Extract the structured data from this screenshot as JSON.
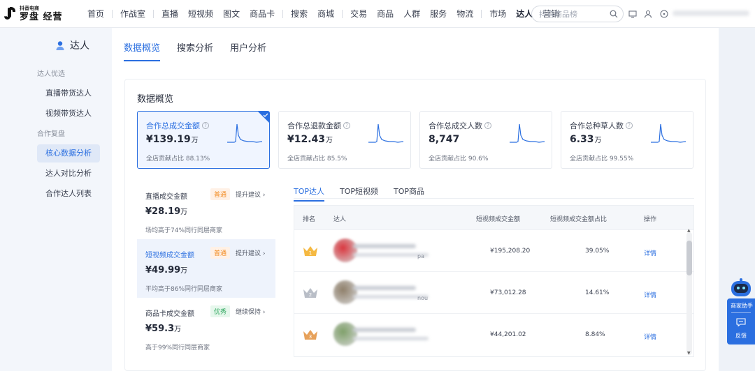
{
  "logo": {
    "small": "抖音电商",
    "big": "罗盘 经营"
  },
  "nav": [
    {
      "label": "首页"
    },
    {
      "sep": true
    },
    {
      "label": "作战室"
    },
    {
      "sep": true
    },
    {
      "label": "直播"
    },
    {
      "label": "短视频"
    },
    {
      "label": "图文"
    },
    {
      "label": "商品卡"
    },
    {
      "sep": true
    },
    {
      "label": "搜索"
    },
    {
      "label": "商城"
    },
    {
      "sep": true
    },
    {
      "label": "交易"
    },
    {
      "label": "商品"
    },
    {
      "label": "人群"
    },
    {
      "label": "服务"
    },
    {
      "label": "物流"
    },
    {
      "sep": true
    },
    {
      "label": "市场"
    },
    {
      "label": "达人",
      "active": true
    },
    {
      "label": "营销"
    }
  ],
  "search": {
    "placeholder": "抖音商品榜"
  },
  "sidebar": {
    "title": "达人",
    "groups": [
      {
        "name": "达人优选",
        "items": [
          {
            "label": "直播带货达人"
          },
          {
            "label": "视频带货达人"
          }
        ]
      },
      {
        "name": "合作复盘",
        "items": [
          {
            "label": "核心数据分析",
            "active": true
          },
          {
            "label": "达人对比分析"
          },
          {
            "label": "合作达人列表"
          }
        ]
      }
    ]
  },
  "tabs": [
    {
      "label": "数据概览",
      "active": true
    },
    {
      "label": "搜索分析"
    },
    {
      "label": "用户分析"
    }
  ],
  "panel_title": "数据概览",
  "kpis": [
    {
      "label": "合作总成交金额",
      "value": "¥139.19",
      "unit": "万",
      "sub": "全店贡献占比 88.13%",
      "active": true
    },
    {
      "label": "合作总退款金额",
      "value": "¥12.43",
      "unit": "万",
      "sub": "全店贡献占比 85.5%"
    },
    {
      "label": "合作总成交人数",
      "value": "8,747",
      "unit": "",
      "sub": "全店贡献占比 90.6%"
    },
    {
      "label": "合作总种草人数",
      "value": "6.33",
      "unit": "万",
      "sub": "全店贡献占比 99.55%"
    }
  ],
  "metrics": [
    {
      "label": "直播成交金额",
      "badge": "普通",
      "badge_type": "normal",
      "advice": "提升建议 ›",
      "value": "¥28.19",
      "unit": "万",
      "sub": "场均高于74%同行同层商家"
    },
    {
      "label": "短视频成交金额",
      "badge": "普通",
      "badge_type": "normal",
      "advice": "提升建议 ›",
      "value": "¥49.99",
      "unit": "万",
      "sub": "平均高于86%同行同层商家",
      "active": true
    },
    {
      "label": "商品卡成交金额",
      "badge": "优秀",
      "badge_type": "good",
      "advice": "继续保持 ›",
      "value": "¥59.3",
      "unit": "万",
      "sub": "高于99%同行同层商家"
    }
  ],
  "sub_tabs": [
    {
      "label": "TOP达人",
      "active": true
    },
    {
      "label": "TOP短视频"
    },
    {
      "label": "TOP商品"
    }
  ],
  "table": {
    "headers": {
      "rank": "排名",
      "talent": "达人",
      "gmv": "短视频成交金额",
      "share": "短视频成交金额占比",
      "op": "操作"
    },
    "rows": [
      {
        "rank": "1",
        "suffix": "pa",
        "gmv": "¥195,208.20",
        "share": "39.05%",
        "op": "详情",
        "medal": "#f5b942",
        "avatar": "#d9363e"
      },
      {
        "rank": "2",
        "suffix": "nou",
        "gmv": "¥73,012.28",
        "share": "14.61%",
        "op": "详情",
        "medal": "#b9bec7",
        "avatar": "#8f7f6a"
      },
      {
        "rank": "3",
        "suffix": "",
        "gmv": "¥44,201.02",
        "share": "8.84%",
        "op": "详情",
        "medal": "#e7a15a",
        "avatar": "#7fa06a"
      }
    ]
  },
  "helper": {
    "label1": "商家助手",
    "label2": "反馈"
  },
  "colors": {
    "accent": "#2b6fe0",
    "normal_badge": "#f2891d",
    "good_badge": "#29a55a"
  }
}
